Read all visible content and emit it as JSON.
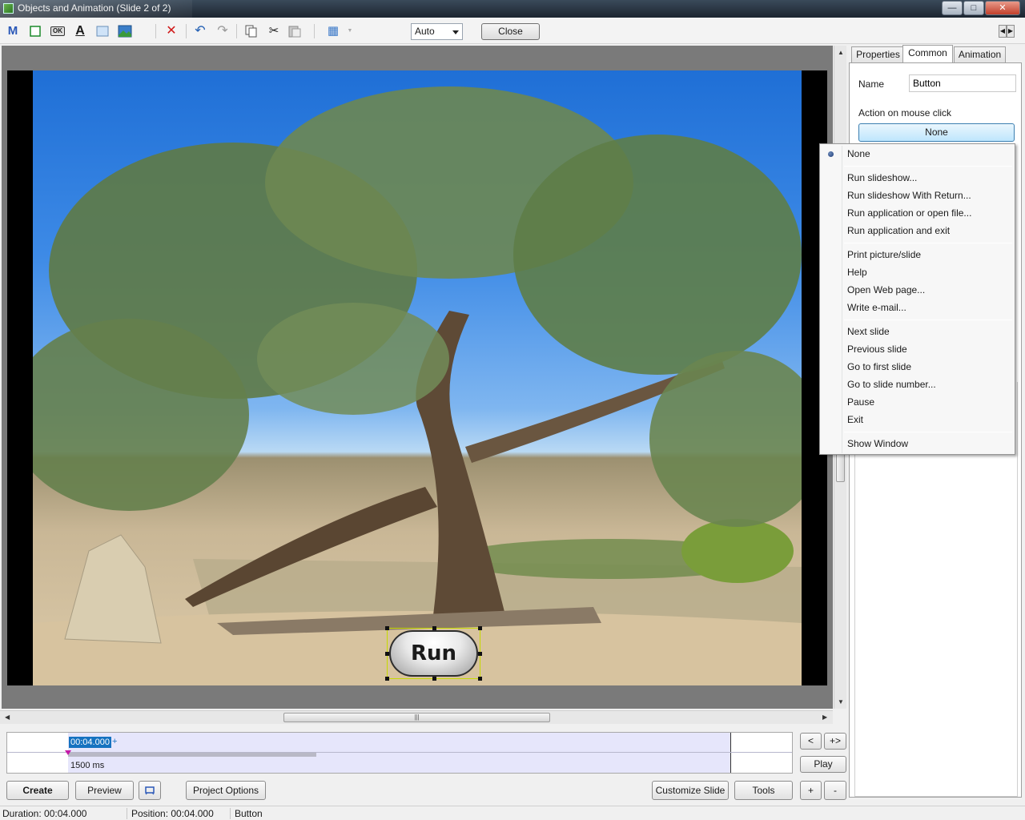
{
  "window": {
    "title": "Objects and Animation  (Slide 2 of 2)",
    "controls": {
      "minimize": "—",
      "maximize": "□",
      "close": "✕"
    }
  },
  "toolbar": {
    "icons": [
      "add-text-M-icon",
      "add-rectangle-icon",
      "add-button-icon",
      "add-text-icon",
      "add-frame-icon",
      "add-image-icon",
      "delete-icon",
      "undo-icon",
      "redo-icon",
      "copy-icon",
      "cut-icon",
      "paste-icon",
      "grid-icon"
    ],
    "glyphs": {
      "m": "M",
      "text": "A",
      "ok": "OK",
      "delete": "✕",
      "undo": "↶",
      "redo": "↷",
      "cut": "✂",
      "grid": "▦"
    },
    "zoom_value": "Auto",
    "close_label": "Close",
    "nav": {
      "left": "◀",
      "right": "▶"
    }
  },
  "slide": {
    "button_text": "Run"
  },
  "timeline": {
    "position_time": "00:04.000",
    "plus": "+",
    "duration_label": "1500 ms",
    "prev_label": "<",
    "expand_label": "+>",
    "play_label": "Play"
  },
  "bottom_buttons": {
    "create": "Create",
    "preview": "Preview",
    "project_options": "Project Options",
    "customize_slide": "Customize Slide",
    "tools": "Tools",
    "plus": "+",
    "minus": "-"
  },
  "status": {
    "duration": "Duration:  00:04.000",
    "position": "Position:  00:04.000",
    "object": "Button"
  },
  "panel": {
    "tabs": [
      "Properties",
      "Common",
      "Animation"
    ],
    "active_tab": "Common",
    "name_label": "Name",
    "name_value": "Button",
    "action_label": "Action on mouse click",
    "action_value": "None"
  },
  "menu": {
    "selected": "None",
    "groups": [
      [
        "None"
      ],
      [
        "Run slideshow...",
        "Run slideshow With Return...",
        "Run application or open file...",
        "Run application and exit"
      ],
      [
        "Print picture/slide",
        "Help",
        "Open Web page...",
        "Write e-mail..."
      ],
      [
        "Next slide",
        "Previous slide",
        "Go to first slide",
        "Go to slide number...",
        "Pause",
        "Exit"
      ],
      [
        "Show Window"
      ]
    ]
  },
  "colors": {
    "selection_blue": "#1672c0",
    "timeline_band": "#e6e6fb",
    "canvas_bg": "#7a7a7a",
    "menu_bg": "#f7f7f7"
  }
}
